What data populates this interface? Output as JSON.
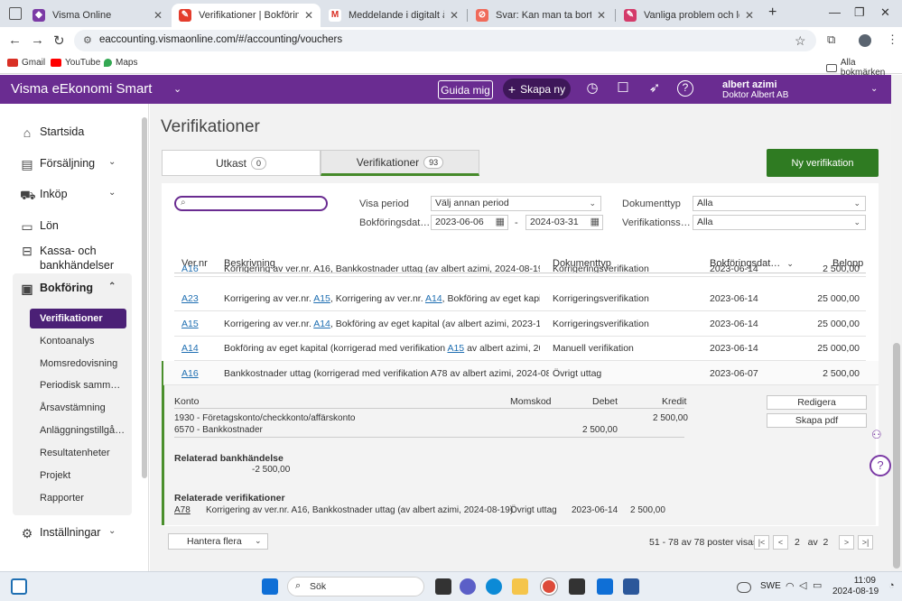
{
  "browser": {
    "tabs": [
      {
        "label": "Visma Online",
        "active": false
      },
      {
        "label": "Verifikationer | Bokföring",
        "active": true
      },
      {
        "label": "Meddelande i digitalt årsredov",
        "active": false
      },
      {
        "label": "Svar: Kan man ta bort räkensk",
        "active": false
      },
      {
        "label": "Vanliga problem och lösningar",
        "active": false
      }
    ],
    "url": "eaccounting.vismaonline.com/#/accounting/vouchers",
    "bookmarks": [
      {
        "label": "Gmail"
      },
      {
        "label": "YouTube"
      },
      {
        "label": "Maps"
      }
    ],
    "all_bookmarks": "Alla bokmärken"
  },
  "header": {
    "title": "Visma eEkonomi Smart",
    "guide": "Guida mig",
    "create": "Skapa ny",
    "user_name": "albert azimi",
    "company": "Doktor Albert AB"
  },
  "sidebar": {
    "items": [
      {
        "label": "Startsida"
      },
      {
        "label": "Försäljning"
      },
      {
        "label": "Inköp"
      },
      {
        "label": "Lön"
      },
      {
        "label": "Kassa- och"
      },
      {
        "label": "bankhändelser"
      },
      {
        "label": "Bokföring"
      },
      {
        "label": "Inställningar"
      }
    ],
    "sub": [
      {
        "label": "Verifikationer"
      },
      {
        "label": "Kontoanalys"
      },
      {
        "label": "Momsredovisning"
      },
      {
        "label": "Periodisk samm…"
      },
      {
        "label": "Årsavstämning"
      },
      {
        "label": "Anläggningstillgå…"
      },
      {
        "label": "Resultatenheter"
      },
      {
        "label": "Projekt"
      },
      {
        "label": "Rapporter"
      }
    ]
  },
  "page": {
    "title": "Verifikationer",
    "tab_draft": "Utkast",
    "tab_draft_count": "0",
    "tab_ver": "Verifikationer",
    "tab_ver_count": "93",
    "new_button": "Ny verifikation"
  },
  "filters": {
    "period_label": "Visa period",
    "period_value": "Välj annan period",
    "date_label": "Bokföringsdat…",
    "date_from": "2023-06-06",
    "date_sep": "-",
    "date_to": "2024-03-31",
    "doctype_label": "Dokumenttyp",
    "doctype_value": "Alla",
    "verif_label": "Verifikationss…",
    "verif_value": "Alla"
  },
  "table": {
    "headers": {
      "nr": "Ver.nr",
      "desc": "Beskrivning",
      "doctype": "Dokumenttyp",
      "date": "Bokföringsdat…",
      "amount": "Belopp"
    },
    "partial_row": {
      "nr": "A16",
      "desc": "Korrigering av ver.nr. A16, Bankkostnader uttag (av albert azimi, 2024-08-19)",
      "doctype": "Korrigeringsverifikation",
      "date": "2023-06-14",
      "amount": "2 500,00"
    },
    "rows": [
      {
        "nr": "A23",
        "d1": "Korrigering av ver.nr. ",
        "l1": "A15",
        "d2": ", Korrigering av ver.nr. ",
        "l2": "A14",
        "d3": ", Bokföring av eget kapital (av…",
        "doctype": "Korrigeringsverifikation",
        "date": "2023-06-14",
        "amount": "25 000,00"
      },
      {
        "nr": "A15",
        "d1": "Korrigering av ver.nr. ",
        "l1": "A14",
        "d2": ", Bokföring av eget kapital (av albert azimi, 2023-11-14) (…",
        "l2": "",
        "d3": "",
        "doctype": "Korrigeringsverifikation",
        "date": "2023-06-14",
        "amount": "25 000,00"
      },
      {
        "nr": "A14",
        "d1": "Bokföring av eget kapital (korrigerad med verifikation ",
        "l1": "A15",
        "d2": " av albert azimi, 2023-1…",
        "l2": "",
        "d3": "",
        "doctype": "Manuell verifikation",
        "date": "2023-06-14",
        "amount": "25 000,00"
      }
    ],
    "expanded": {
      "nr": "A16",
      "desc": "Bankkostnader uttag (korrigerad med verifikation A78 av albert azimi, 2024-08-19)",
      "doctype": "Övrigt uttag",
      "date": "2023-06-07",
      "amount": "2 500,00"
    }
  },
  "detail": {
    "h_konto": "Konto",
    "h_moms": "Momskod",
    "h_debet": "Debet",
    "h_kredit": "Kredit",
    "line1_account": "1930 - Företagskonto/checkkonto/affärskonto",
    "line1_kredit": "2 500,00",
    "line2_account": "6570 - Bankkostnader",
    "line2_debet": "2 500,00",
    "edit": "Redigera",
    "pdf": "Skapa pdf",
    "bank_title": "Relaterad bankhändelse",
    "bank_amount": "-2 500,00",
    "rel_title": "Relaterade verifikationer",
    "rel_nr": "A78",
    "rel_desc": "Korrigering av ver.nr. A16, Bankkostnader uttag (av albert azimi, 2024-08-19)",
    "rel_type": "Övrigt uttag",
    "rel_date": "2023-06-14",
    "rel_amount": "2 500,00"
  },
  "footer": {
    "manage": "Hantera flera",
    "info": "51 - 78 av 78 poster visas",
    "page": "2",
    "of": "av",
    "total": "2"
  },
  "taskbar": {
    "search": "Sök",
    "lang": "SWE",
    "time": "11:09",
    "date": "2024-08-19"
  },
  "colors": {
    "brand": "#6a2c91",
    "active_nav": "#4b2076",
    "primary_button": "#2f7b22",
    "link": "#1f6fb2"
  }
}
